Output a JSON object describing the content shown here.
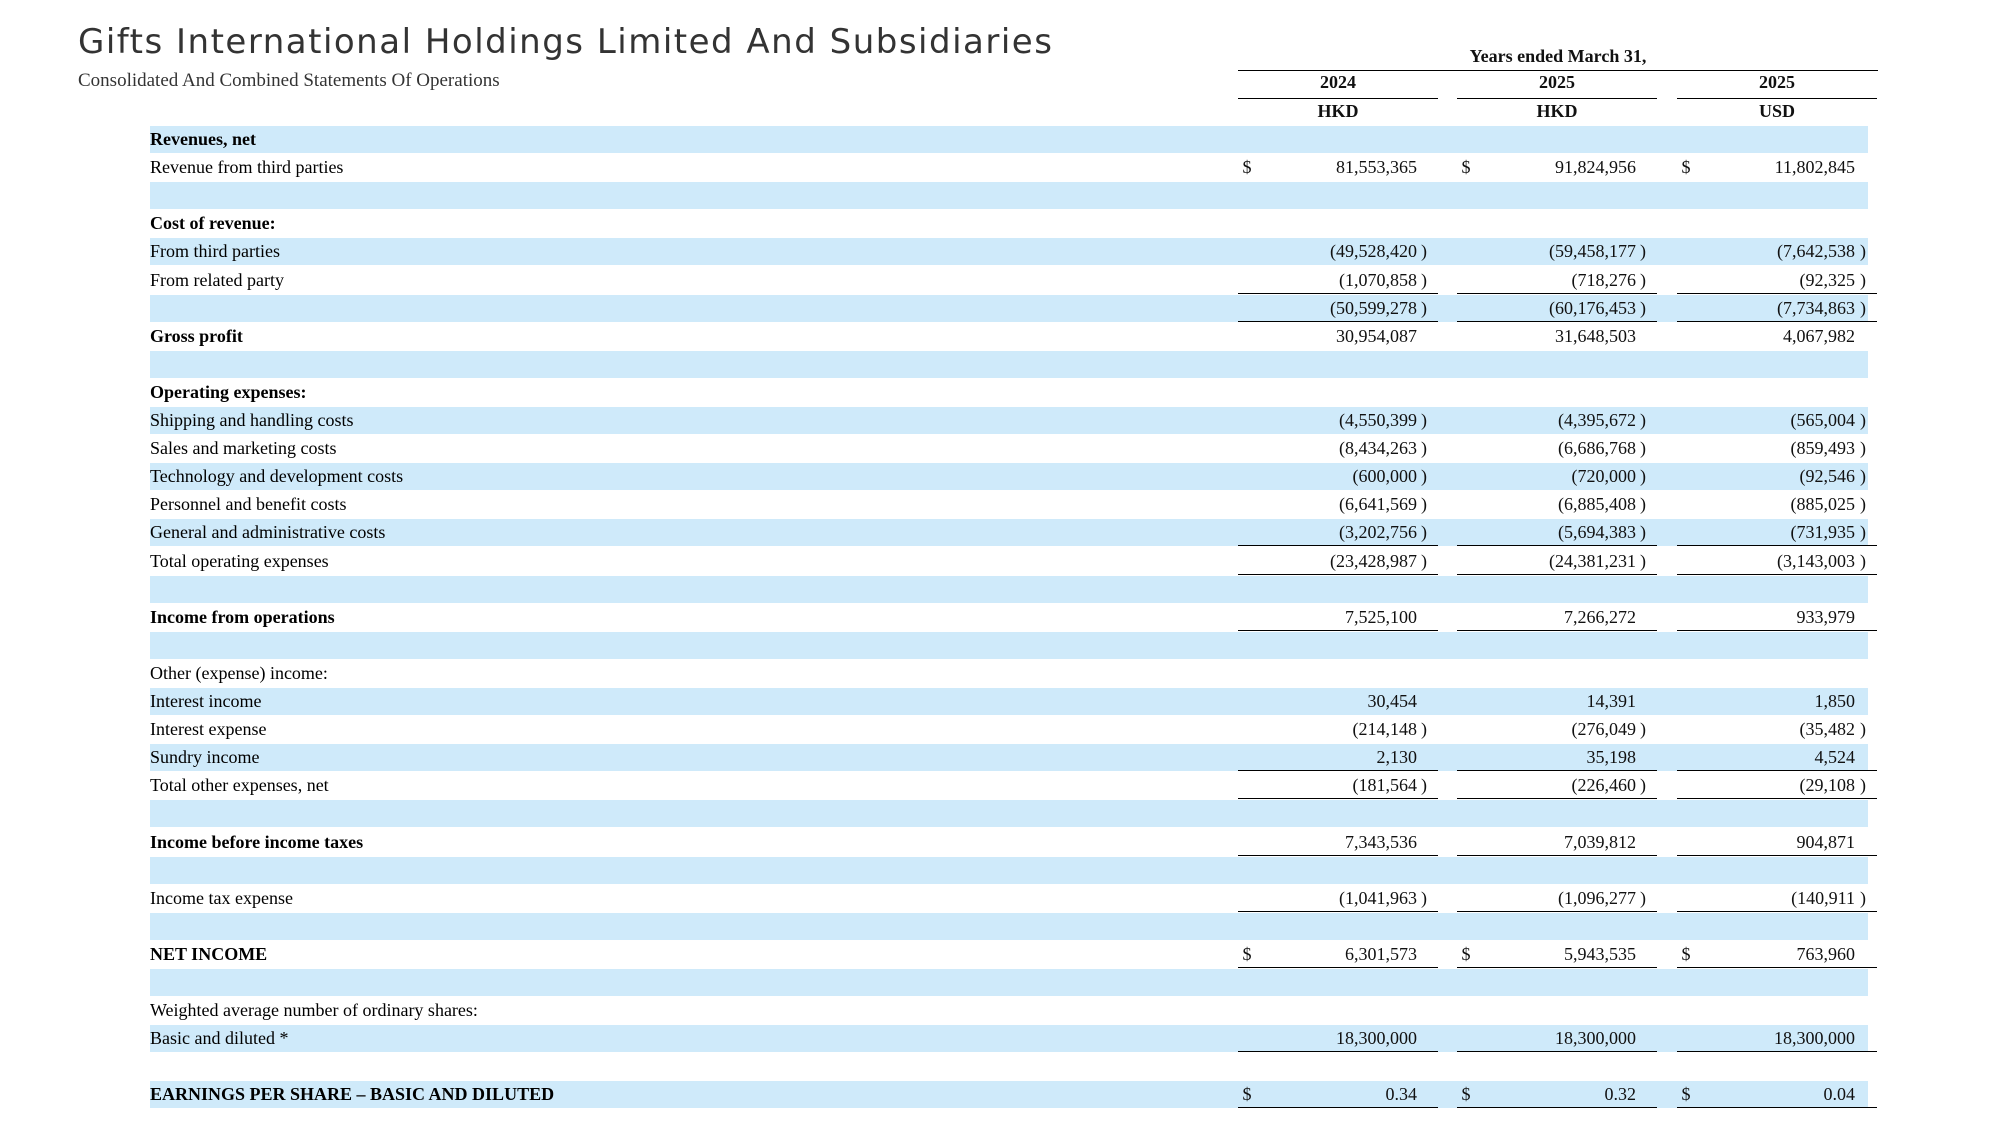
{
  "document": {
    "title": "Gifts International Holdings Limited And Subsidiaries",
    "subtitle": "Consolidated And Combined Statements Of Operations"
  },
  "table": {
    "period_header": "Years ended March 31,",
    "columns": [
      {
        "year": "2024",
        "currency": "HKD"
      },
      {
        "year": "2025",
        "currency": "HKD"
      },
      {
        "year": "2025",
        "currency": "USD"
      }
    ],
    "rows": [
      {
        "label": "Revenues, net",
        "bold": true,
        "shaded": true,
        "values": []
      },
      {
        "label": "Revenue from third parties",
        "bold": false,
        "shaded": false,
        "dollar": true,
        "values": [
          "81,553,365",
          "91,824,956",
          "11,802,845"
        ]
      },
      {
        "label": "",
        "bold": false,
        "shaded": true,
        "values": []
      },
      {
        "label": "Cost of revenue:",
        "bold": true,
        "shaded": false,
        "values": []
      },
      {
        "label": "From third parties",
        "bold": false,
        "shaded": true,
        "values": [
          "(49,528,420",
          "(59,458,177",
          "(7,642,538"
        ]
      },
      {
        "label": "From related party",
        "bold": false,
        "shaded": false,
        "underline": "single",
        "values": [
          "(1,070,858",
          "(718,276",
          "(92,325"
        ]
      },
      {
        "label": "",
        "bold": false,
        "shaded": true,
        "underline": "single",
        "values": [
          "(50,599,278",
          "(60,176,453",
          "(7,734,863"
        ]
      },
      {
        "label": "Gross profit",
        "bold": true,
        "shaded": false,
        "values": [
          "30,954,087",
          "31,648,503",
          "4,067,982"
        ]
      },
      {
        "label": "",
        "bold": false,
        "shaded": true,
        "values": []
      },
      {
        "label": "Operating expenses:",
        "bold": true,
        "shaded": false,
        "values": []
      },
      {
        "label": "Shipping and handling costs",
        "bold": false,
        "shaded": true,
        "values": [
          "(4,550,399",
          "(4,395,672",
          "(565,004"
        ]
      },
      {
        "label": "Sales and marketing costs",
        "bold": false,
        "shaded": false,
        "values": [
          "(8,434,263",
          "(6,686,768",
          "(859,493"
        ]
      },
      {
        "label": "Technology and development costs",
        "bold": false,
        "shaded": true,
        "values": [
          "(600,000",
          "(720,000",
          "(92,546"
        ]
      },
      {
        "label": "Personnel and benefit costs",
        "bold": false,
        "shaded": false,
        "values": [
          "(6,641,569",
          "(6,885,408",
          "(885,025"
        ]
      },
      {
        "label": "General and administrative costs",
        "bold": false,
        "shaded": true,
        "underline": "single",
        "values": [
          "(3,202,756",
          "(5,694,383",
          "(731,935"
        ]
      },
      {
        "label": "Total operating expenses",
        "bold": false,
        "shaded": false,
        "underline": "single",
        "values": [
          "(23,428,987",
          "(24,381,231",
          "(3,143,003"
        ]
      },
      {
        "label": "",
        "bold": false,
        "shaded": true,
        "values": []
      },
      {
        "label": "Income from operations",
        "bold": true,
        "shaded": false,
        "underline": "single",
        "values": [
          "7,525,100",
          "7,266,272",
          "933,979"
        ]
      },
      {
        "label": "",
        "bold": false,
        "shaded": true,
        "values": []
      },
      {
        "label": "Other (expense) income:",
        "bold": false,
        "shaded": false,
        "values": []
      },
      {
        "label": "Interest income",
        "bold": false,
        "shaded": true,
        "values": [
          "30,454",
          "14,391",
          "1,850"
        ]
      },
      {
        "label": "Interest expense",
        "bold": false,
        "shaded": false,
        "values": [
          "(214,148",
          "(276,049",
          "(35,482"
        ]
      },
      {
        "label": "Sundry income",
        "bold": false,
        "shaded": true,
        "underline": "single",
        "values": [
          "2,130",
          "35,198",
          "4,524"
        ]
      },
      {
        "label": "Total other expenses, net",
        "bold": false,
        "shaded": false,
        "underline": "single",
        "values": [
          "(181,564",
          "(226,460",
          "(29,108"
        ]
      },
      {
        "label": "",
        "bold": false,
        "shaded": true,
        "values": []
      },
      {
        "label": "Income before income taxes",
        "bold": true,
        "shaded": false,
        "underline": "single",
        "values": [
          "7,343,536",
          "7,039,812",
          "904,871"
        ]
      },
      {
        "label": "",
        "bold": false,
        "shaded": true,
        "values": []
      },
      {
        "label": "Income tax expense",
        "bold": false,
        "shaded": false,
        "underline": "single",
        "values": [
          "(1,041,963",
          "(1,096,277",
          "(140,911"
        ]
      },
      {
        "label": "",
        "bold": false,
        "shaded": true,
        "values": []
      },
      {
        "label": "NET INCOME",
        "bold": true,
        "shaded": false,
        "dollar": true,
        "underline": "single",
        "values": [
          "6,301,573",
          "5,943,535",
          "763,960"
        ]
      },
      {
        "label": "",
        "bold": false,
        "shaded": true,
        "values": []
      },
      {
        "label": "Weighted average number of ordinary shares:",
        "bold": false,
        "shaded": false,
        "values": []
      },
      {
        "label": "Basic and diluted *",
        "bold": false,
        "shaded": true,
        "underline": "single",
        "values": [
          "18,300,000",
          "18,300,000",
          "18,300,000"
        ]
      },
      {
        "label": "",
        "bold": false,
        "shaded": false,
        "values": []
      },
      {
        "label": "EARNINGS PER SHARE – BASIC AND DILUTED",
        "bold": true,
        "shaded": true,
        "dollar": true,
        "underline": "single",
        "values": [
          "0.34",
          "0.32",
          "0.04"
        ]
      }
    ],
    "currency_symbol": "$",
    "close_paren": ")"
  }
}
